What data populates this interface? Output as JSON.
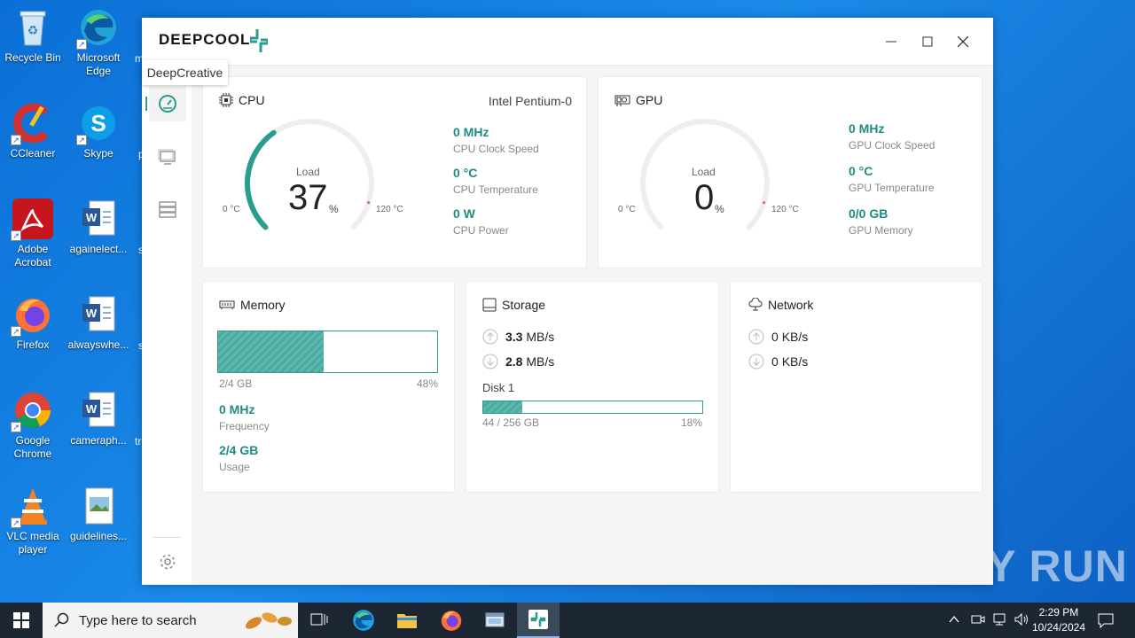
{
  "desktop": {
    "icons": [
      {
        "label": "Recycle Bin"
      },
      {
        "label": "Microsoft Edge"
      },
      {
        "label": "CCleaner"
      },
      {
        "label": "Skype"
      },
      {
        "label": "Adobe Acrobat"
      },
      {
        "label": "againelect..."
      },
      {
        "label": "Firefox"
      },
      {
        "label": "alwayswhe..."
      },
      {
        "label": "Google Chrome"
      },
      {
        "label": "cameraph..."
      },
      {
        "label": "VLC media player"
      },
      {
        "label": "guidelines..."
      }
    ],
    "partial_labels": [
      "m",
      "p",
      "s",
      "s",
      "tr"
    ]
  },
  "app": {
    "brand": "DEEPCOOL",
    "tooltip": "DeepCreative",
    "accent": "#2a9d8f",
    "cpu": {
      "title": "CPU",
      "model": "Intel Pentium-0",
      "gauge_label": "Load",
      "gauge_value": "37",
      "gauge_unit": "%",
      "gauge_min": "0 °C",
      "gauge_max": "120 °C",
      "load_fraction": 0.37,
      "stats": [
        {
          "value": "0 MHz",
          "label": "CPU Clock Speed"
        },
        {
          "value": "0 °C",
          "label": "CPU Temperature"
        },
        {
          "value": "0 W",
          "label": "CPU Power"
        }
      ]
    },
    "gpu": {
      "title": "GPU",
      "gauge_label": "Load",
      "gauge_value": "0",
      "gauge_unit": "%",
      "gauge_min": "0 °C",
      "gauge_max": "120 °C",
      "load_fraction": 0,
      "stats": [
        {
          "value": "0 MHz",
          "label": "GPU Clock Speed"
        },
        {
          "value": "0 °C",
          "label": "GPU Temperature"
        },
        {
          "value": "0/0 GB",
          "label": "GPU Memory"
        }
      ]
    },
    "memory": {
      "title": "Memory",
      "used": "2/4 GB",
      "percent": "48%",
      "fill_fraction": 0.48,
      "freq_value": "0 MHz",
      "freq_label": "Frequency",
      "usage_value": "2/4 GB",
      "usage_label": "Usage"
    },
    "storage": {
      "title": "Storage",
      "upload_value": "3.3",
      "upload_unit": "MB/s",
      "download_value": "2.8",
      "download_unit": "MB/s",
      "disk_label": "Disk 1",
      "disk_used": "44 / 256 GB",
      "disk_percent": "18%",
      "fill_fraction": 0.18
    },
    "network": {
      "title": "Network",
      "upload_value": "0",
      "upload_unit": "KB/s",
      "download_value": "0",
      "download_unit": "KB/s"
    }
  },
  "taskbar": {
    "search_placeholder": "Type here to search",
    "time": "2:29 PM",
    "date": "10/24/2024"
  },
  "watermark": "ANY RUN"
}
